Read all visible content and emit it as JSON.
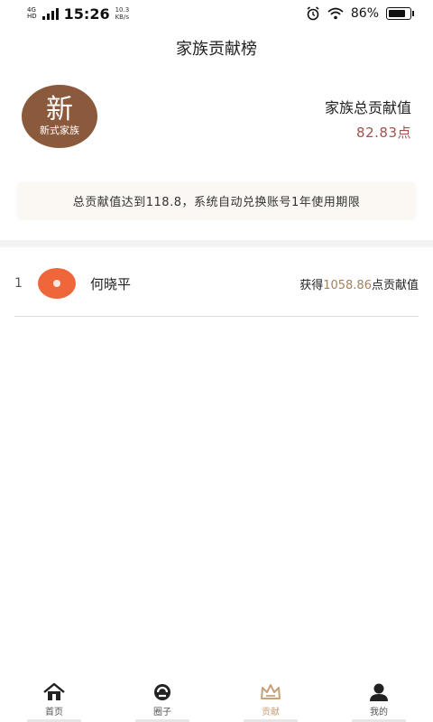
{
  "status_bar": {
    "network": "4G",
    "network_sub": "HD",
    "time": "15:26",
    "speed_value": "10.3",
    "speed_unit": "KB/s",
    "battery": "86%",
    "battery_level": 0.86
  },
  "page": {
    "title": "家族贡献榜"
  },
  "family": {
    "logo_main": "新",
    "logo_sub": "新式家族",
    "total_label": "家族总贡献值",
    "total_value": "82.83点"
  },
  "notice": "总贡献值达到118.8，系统自动兑换账号1年使用期限",
  "ranking": [
    {
      "rank": "1",
      "name": "何晓平",
      "points_prefix": "获得",
      "points_value": "1058.86",
      "points_suffix": "点贡献值"
    }
  ],
  "tabs": [
    {
      "label": "首页",
      "icon": "home-icon"
    },
    {
      "label": "圈子",
      "icon": "circle-icon"
    },
    {
      "label": "贡献",
      "icon": "crown-icon",
      "active": true
    },
    {
      "label": "我的",
      "icon": "user-icon"
    }
  ],
  "colors": {
    "accent": "#a2524a",
    "gold": "#c8a07c",
    "logo_bg": "#8b5a3c",
    "avatar_bg": "#f0663b"
  }
}
